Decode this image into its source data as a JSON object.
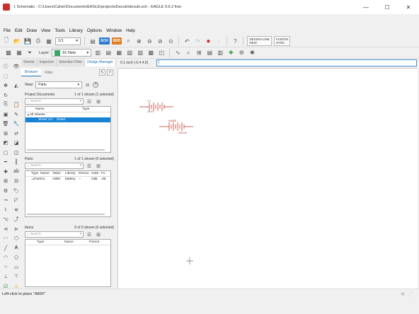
{
  "window": {
    "title": "1 Schematic - C:\\Users\\Calvin\\Documents\\EAGLE\\projects\\Dezuki\\dezuki.sch - EAGLE 9.6.2 free",
    "controls": [
      "—",
      "☐",
      "✕"
    ]
  },
  "menu": [
    "File",
    "Edit",
    "Draw",
    "View",
    "Tools",
    "Library",
    "Options",
    "Window",
    "Help"
  ],
  "toolbar1": {
    "sheet_select": "1/1",
    "badge_sch": "SCH",
    "badge_brd": "BRD",
    "design_link": "DESIGN LINK",
    "design_link_sub": "NEW",
    "fusion_label": "FUSION",
    "fusion_sub": "SYNC"
  },
  "toolbar2": {
    "layer_label": "Layer:",
    "layer_value": "91 Nets"
  },
  "panel": {
    "tabs": [
      "Sheets",
      "Inspector",
      "Selection Filter",
      "Design Manager"
    ],
    "active_tab": "Design Manager",
    "subtabs": [
      "Browser",
      "Filter"
    ],
    "view_label": "View:",
    "view_value": "Parts",
    "project_documents": {
      "title": "Project Documents",
      "status": "1 of 1 shown (1 selected)",
      "search_placeholder": "Search",
      "columns": [
        "Name",
        "Type"
      ],
      "rows": [
        {
          "name": "All Sheets",
          "type": ""
        },
        {
          "name": "Sheet 1/1",
          "type": "Sheet"
        }
      ]
    },
    "parts": {
      "title": "Parts",
      "status": "1 of 1 shown (0 selected)",
      "search_placeholder": "Search",
      "columns": [
        "Type",
        "Name",
        "Value",
        "Library",
        "Device",
        "Gate",
        "Fo"
      ],
      "rows": [
        {
          "type": "Part",
          "name": "G1",
          "value": "A89V",
          "library": "battery",
          "device": "--",
          "gate": "G$1",
          "fo": "AB"
        }
      ]
    },
    "items": {
      "title": "Items",
      "status": "0 of 0 shown (0 selected)",
      "search_placeholder": "Search",
      "columns": [
        "Type",
        "Name",
        "Parent"
      ]
    }
  },
  "canvas": {
    "coord_readout": "0.1 inch (-0.4 4.0)",
    "command_value": "|",
    "battery_label_1": "G1",
    "battery_value_1": "A89V",
    "battery_label_2": ">NAME",
    "battery_value_2": ">VALUE"
  },
  "status": {
    "message": "Left-click to place \"A89V\""
  },
  "colors": {
    "accent": "#1783d6",
    "symbol_red": "#c0392b",
    "layer_green": "#39a66a"
  }
}
